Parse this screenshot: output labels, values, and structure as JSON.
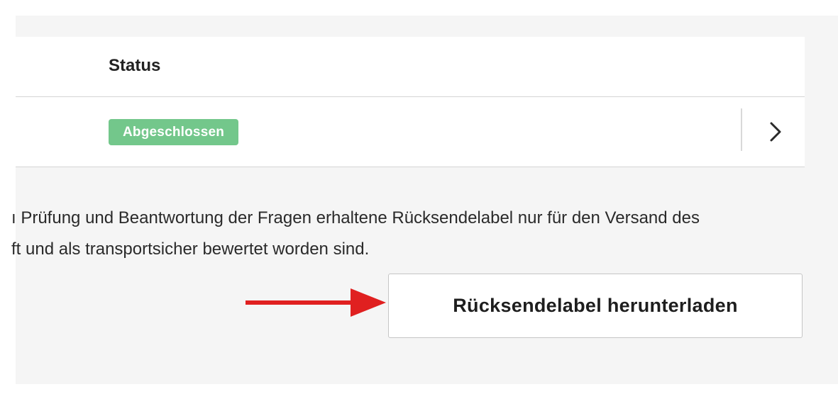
{
  "table": {
    "header": {
      "status_label": "Status"
    },
    "rows": [
      {
        "status_badge": "Abgeschlossen",
        "status_color": "#73c78b",
        "action_icon": "chevron-right-icon"
      }
    ]
  },
  "info": {
    "line1": "ı Prüfung und Beantwortung der Fragen erhaltene Rücksendelabel nur für den Versand des",
    "line2": "ft und als transportsicher bewertet worden sind."
  },
  "annotation": {
    "arrow_icon": "red-arrow-right-icon",
    "arrow_color": "#e02020"
  },
  "download": {
    "button_label": "Rücksendelabel herunterladen"
  }
}
